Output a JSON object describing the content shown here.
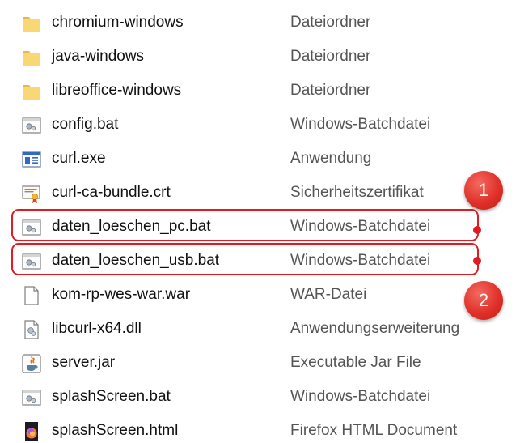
{
  "files": [
    {
      "name": "chromium-windows",
      "type": "Dateiordner",
      "icon": "folder-icon"
    },
    {
      "name": "java-windows",
      "type": "Dateiordner",
      "icon": "folder-icon"
    },
    {
      "name": "libreoffice-windows",
      "type": "Dateiordner",
      "icon": "folder-icon"
    },
    {
      "name": "config.bat",
      "type": "Windows-Batchdatei",
      "icon": "batch-file-icon"
    },
    {
      "name": "curl.exe",
      "type": "Anwendung",
      "icon": "application-icon"
    },
    {
      "name": "curl-ca-bundle.crt",
      "type": "Sicherheitszertifikat",
      "icon": "certificate-icon"
    },
    {
      "name": "daten_loeschen_pc.bat",
      "type": "Windows-Batchdatei",
      "icon": "batch-file-icon"
    },
    {
      "name": "daten_loeschen_usb.bat",
      "type": "Windows-Batchdatei",
      "icon": "batch-file-icon"
    },
    {
      "name": "kom-rp-wes-war.war",
      "type": "WAR-Datei",
      "icon": "blank-file-icon"
    },
    {
      "name": "libcurl-x64.dll",
      "type": "Anwendungserweiterung",
      "icon": "dll-file-icon"
    },
    {
      "name": "server.jar",
      "type": "Executable Jar File",
      "icon": "java-jar-icon"
    },
    {
      "name": "splashScreen.bat",
      "type": "Windows-Batchdatei",
      "icon": "batch-file-icon"
    },
    {
      "name": "splashScreen.html",
      "type": "Firefox HTML Document",
      "icon": "firefox-html-icon"
    }
  ],
  "annotations": [
    {
      "label": "1",
      "row_index": 6
    },
    {
      "label": "2",
      "row_index": 7
    }
  ],
  "colors": {
    "annotation_red": "#e21b23",
    "folder_yellow": "#f8d775",
    "text_primary": "#111111",
    "text_secondary": "#555555"
  }
}
